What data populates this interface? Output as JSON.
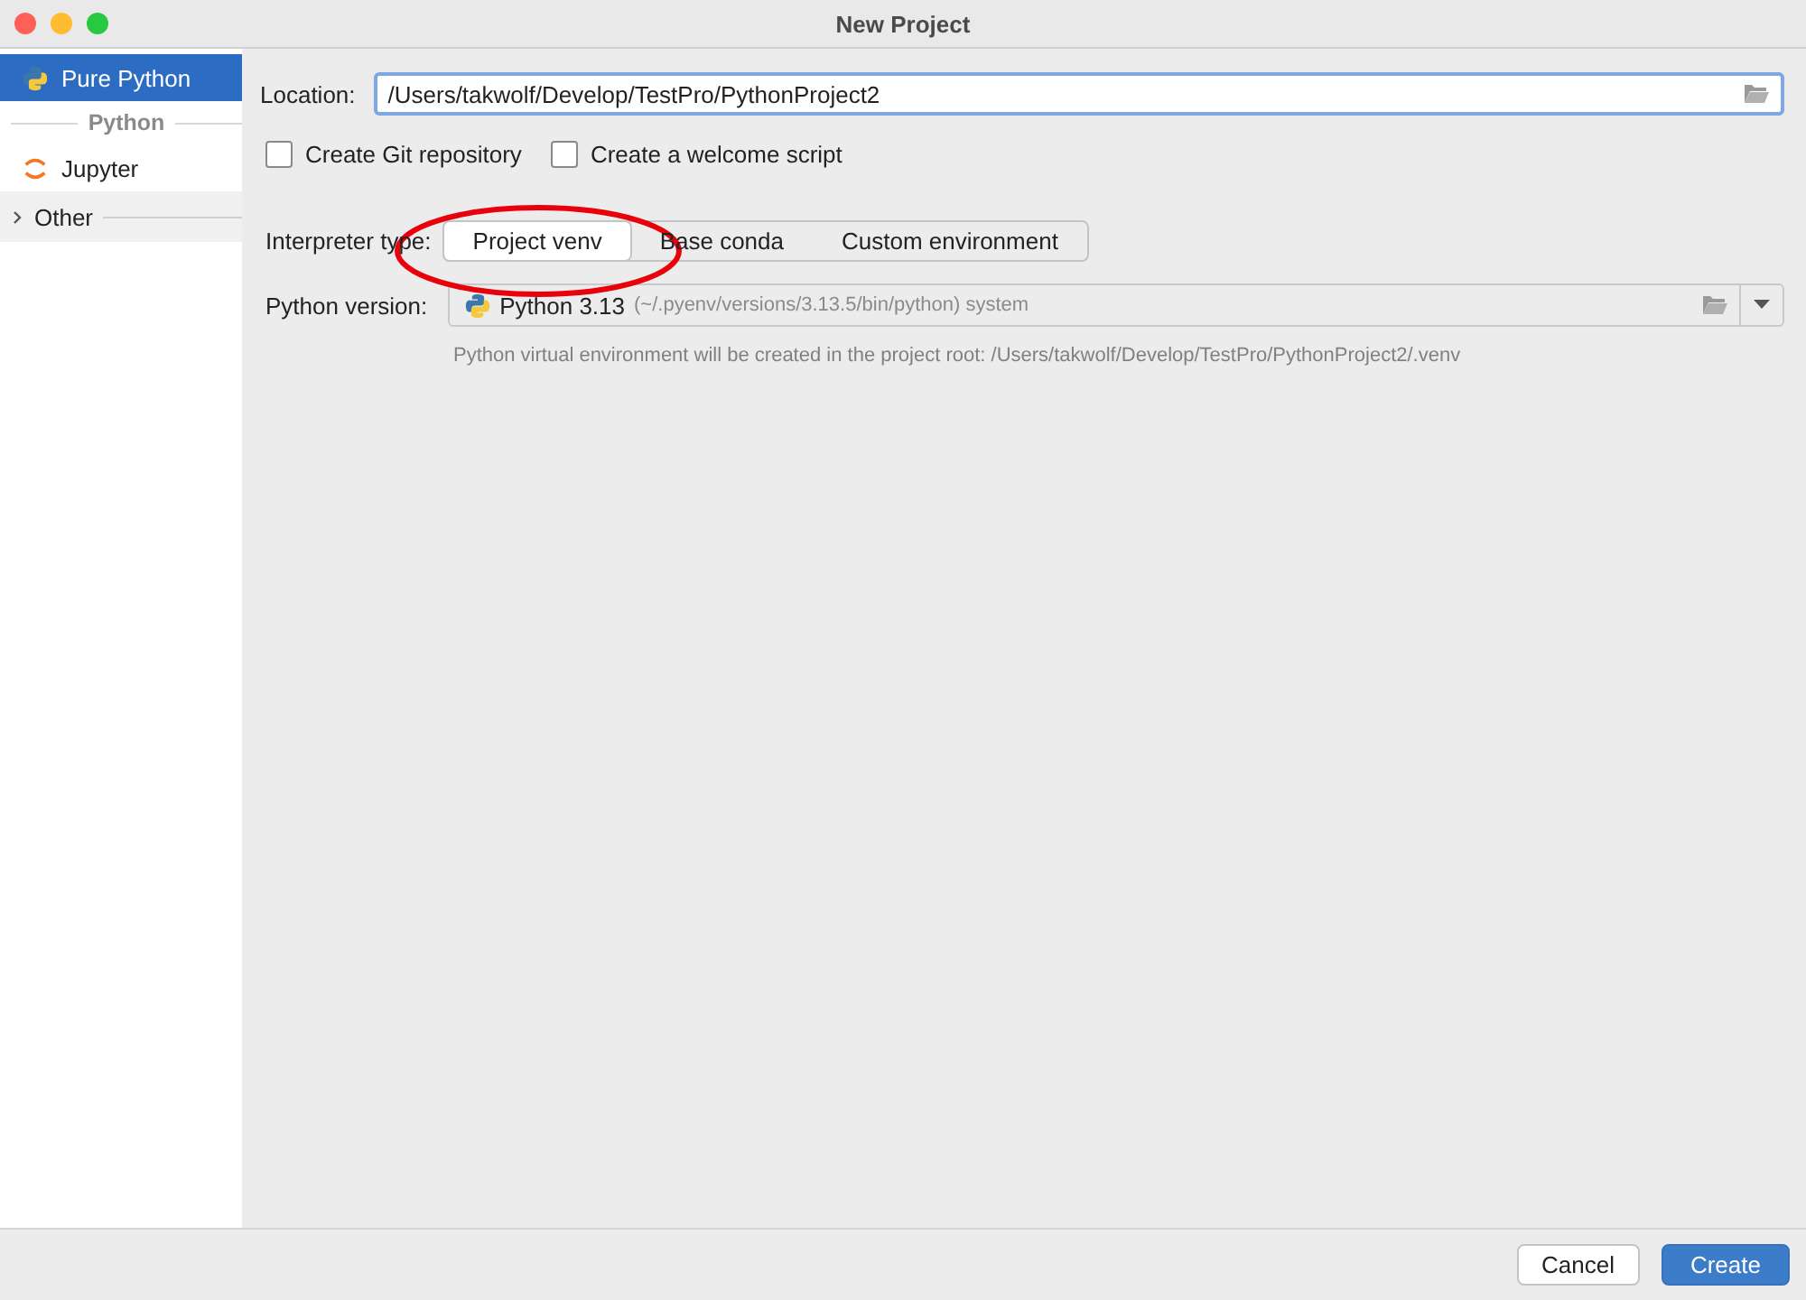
{
  "window": {
    "title": "New Project"
  },
  "sidebar": {
    "items": [
      {
        "kind": "python",
        "label": "Pure Python",
        "selected": true
      },
      {
        "kind": "group",
        "label": "Python"
      },
      {
        "kind": "jupyter",
        "label": "Jupyter",
        "selected": false
      },
      {
        "kind": "collapsible",
        "label": "Other",
        "expanded": false
      }
    ]
  },
  "location": {
    "label": "Location:",
    "value": "/Users/takwolf/Develop/TestPro/PythonProject2"
  },
  "checkboxes": [
    {
      "label": "Create Git repository",
      "checked": false
    },
    {
      "label": "Create a welcome script",
      "checked": false
    }
  ],
  "interpreter_type": {
    "label": "Interpreter type:",
    "options": [
      {
        "label": "Project venv",
        "selected": true
      },
      {
        "label": "Base conda",
        "selected": false
      },
      {
        "label": "Custom environment",
        "selected": false
      }
    ]
  },
  "python_version": {
    "label": "Python version:",
    "value": "Python 3.13",
    "detail": "(~/.pyenv/versions/3.13.5/bin/python) system"
  },
  "hint": "Python virtual environment will be created in the project root: /Users/takwolf/Develop/TestPro/PythonProject2/.venv",
  "buttons": [
    {
      "label": "Cancel",
      "kind": "secondary"
    },
    {
      "label": "Create",
      "kind": "primary"
    }
  ],
  "annotations": [
    {
      "kind": "ellipse"
    }
  ]
}
